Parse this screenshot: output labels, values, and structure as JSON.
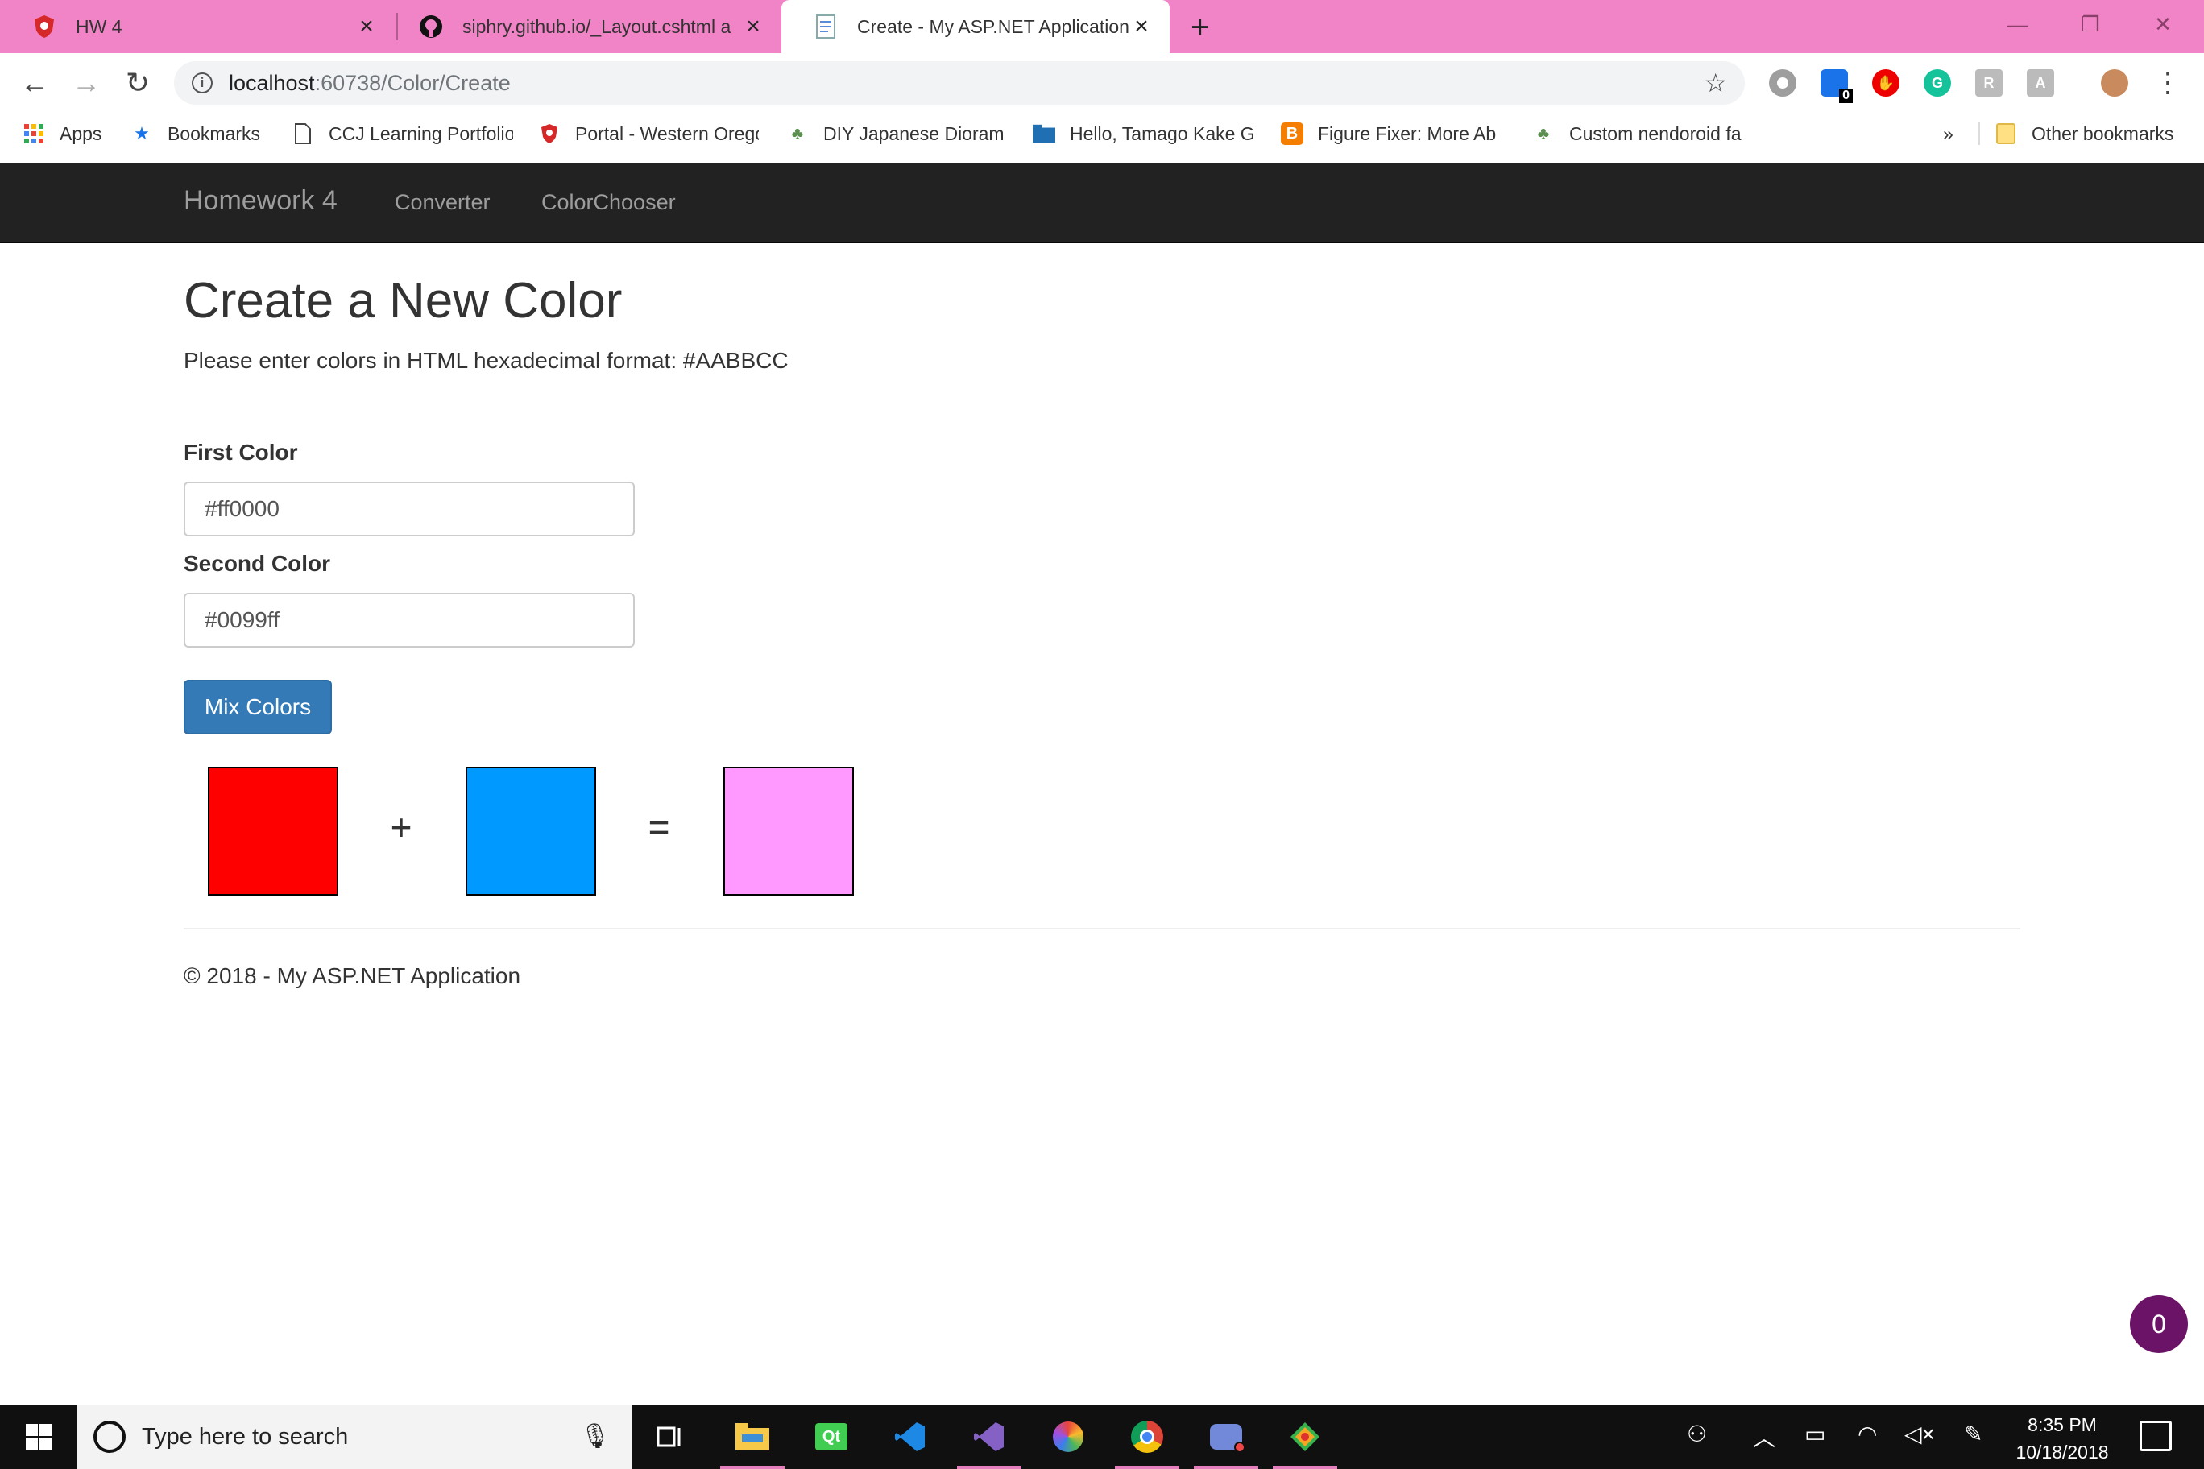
{
  "browser": {
    "tabs": [
      {
        "label": "HW 4",
        "active": false
      },
      {
        "label": "siphry.github.io/_Layout.cshtml a",
        "active": false
      },
      {
        "label": "Create - My ASP.NET Application",
        "active": true
      }
    ],
    "new_tab_icon": "plus-icon",
    "url_host": "localhost",
    "url_path": ":60738/Color/Create",
    "bookmarks": [
      {
        "label": "Apps",
        "icon": "apps-grid-icon"
      },
      {
        "label": "Bookmarks",
        "icon": "star-icon"
      },
      {
        "label": "CCJ Learning Portfolio",
        "icon": "page-icon"
      },
      {
        "label": "Portal - Western Oregon",
        "icon": "shield-icon"
      },
      {
        "label": "DIY Japanese Diorama",
        "icon": "leaf-icon"
      },
      {
        "label": "Hello, Tamago Kake Gohan",
        "icon": "folder-icon"
      },
      {
        "label": "Figure Fixer: More Ab",
        "icon": "blogger-icon"
      },
      {
        "label": "Custom nendoroid fa",
        "icon": "leaf-icon"
      }
    ],
    "overflow_label": "»",
    "other_bookmarks": "Other bookmarks",
    "extension_badge": "0",
    "accent_color": "#f184c6"
  },
  "site": {
    "brand": "Homework 4",
    "nav": [
      "Converter",
      "ColorChooser"
    ],
    "title": "Create a New Color",
    "instructions": "Please enter colors in HTML hexadecimal format: #AABBCC",
    "first_label": "First Color",
    "first_value": "#ff0000",
    "second_label": "Second Color",
    "second_value": "#0099ff",
    "button": "Mix Colors",
    "plus": "+",
    "equals": "=",
    "swatch_colors": {
      "first": "#ff0000",
      "second": "#0099ff",
      "result": "#ff99ff"
    },
    "footer": "© 2018 - My ASP.NET Application",
    "bubble_count": "0"
  },
  "taskbar": {
    "search_placeholder": "Type here to search",
    "time": "8:35 PM",
    "date": "10/18/2018"
  }
}
